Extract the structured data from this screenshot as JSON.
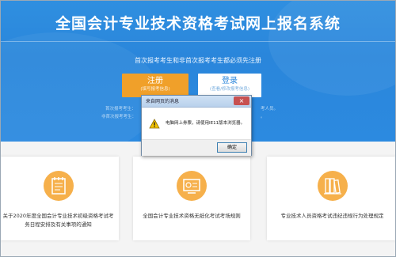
{
  "header": {
    "title": "全国会计专业技术资格考试网上报名系统",
    "notice": "首次报考考生和非首次报考考生都必须先注册"
  },
  "buttons": {
    "register": {
      "label": "注册",
      "sublabel": "(填写报考信息)"
    },
    "login": {
      "label": "登录",
      "sublabel": "(查看/修改报考信息)"
    }
  },
  "hints": {
    "left_line1": "首次报考考生：",
    "left_line2": "非首次报考考生：",
    "right_line1": "考人员。",
    "right_line2": "。"
  },
  "dialog": {
    "title": "来自网页的消息",
    "close_symbol": "×",
    "message": "电脑网上券票，请使用IE11版本浏览器。",
    "ok_label": "确定"
  },
  "cards": [
    {
      "text": "关于2020年度全国会计专业技术初级资格考试考务日程安排及有关事项的通知"
    },
    {
      "text": "全国会计专业技术资格无纸化考试考场规则"
    },
    {
      "text": "专业技术人员资格考试违纪违规行为处理规定"
    }
  ],
  "colors": {
    "hero_blue": "#2a86db",
    "register_orange": "#f0a02a",
    "icon_orange": "#f6b04b"
  }
}
